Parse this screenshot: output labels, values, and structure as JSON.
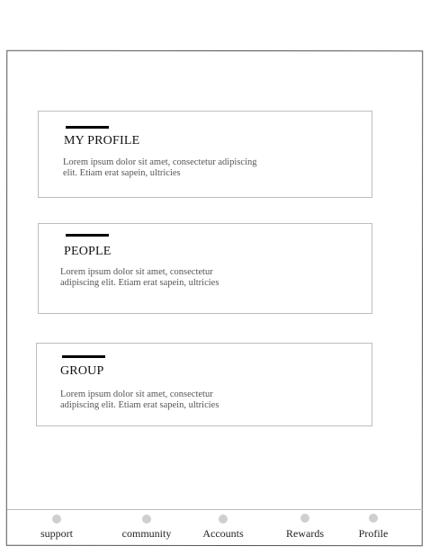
{
  "cards": [
    {
      "title": "MY PROFILE",
      "description": "Lorem ipsum dolor sit amet, consectetur adipiscing elit. Etiam erat sapein, ultricies"
    },
    {
      "title": "PEOPLE",
      "description": "Lorem ipsum dolor sit amet, consectetur adipiscing elit. Etiam erat sapein, ultricies"
    },
    {
      "title": "GROUP",
      "description": "Lorem ipsum dolor sit amet, consectetur adipiscing elit. Etiam erat sapein, ultricies"
    }
  ],
  "tabbar": {
    "items": [
      {
        "label": "support",
        "icon": "circle-icon"
      },
      {
        "label": "community",
        "icon": "circle-icon"
      },
      {
        "label": "Accounts",
        "icon": "circle-icon"
      },
      {
        "label": "Rewards",
        "icon": "circle-icon"
      },
      {
        "label": "Profile",
        "icon": "circle-icon"
      }
    ]
  },
  "colors": {
    "accent_bar": "#000000",
    "card_border": "#bdbdbd",
    "tab_dot": "#cfcfcf"
  }
}
